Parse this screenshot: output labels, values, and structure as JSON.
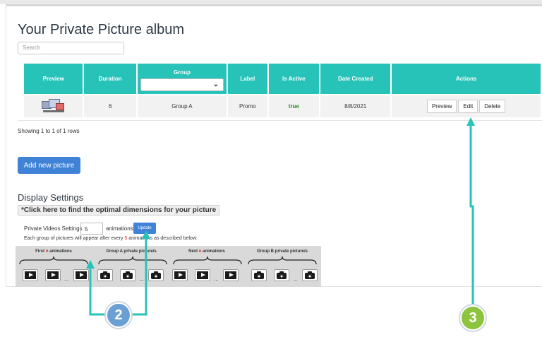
{
  "page": {
    "title": "Your Private Picture album",
    "search_placeholder": "Search"
  },
  "table": {
    "headers": {
      "preview": "Preview",
      "duration": "Duration",
      "group": "Group",
      "label": "Label",
      "is_active": "Is Active",
      "date_created": "Date Created",
      "actions": "Actions"
    },
    "group_filter_value": "",
    "rows": [
      {
        "duration": "6",
        "group": "Group A",
        "label": "Promo",
        "is_active": "true",
        "date_created": "8/8/2021",
        "actions": {
          "preview": "Preview",
          "edit": "Edit",
          "delete": "Delete"
        }
      }
    ],
    "showing_text": "Showing 1 to 1 of 1 rows"
  },
  "add_button_label": "Add new picture",
  "display_settings": {
    "title": "Display Settings",
    "link_text": "*Click here to find the optimal dimensions for your picture",
    "private_videos_label": "Private Videos Settings",
    "animations_value": "5",
    "animations_label": "animations",
    "update_label": "Update",
    "description_before": "Each group of pictures will appear after every",
    "description_value": "5",
    "description_after": "animations as described below:"
  },
  "diagram": {
    "segments": [
      {
        "label_before": "First",
        "label_n": "n",
        "label_after": "animations",
        "icon": "play-icon"
      },
      {
        "label_before": "Group A private picture/s",
        "label_n": "",
        "label_after": "",
        "icon": "camera-icon"
      },
      {
        "label_before": "Next",
        "label_n": "n",
        "label_after": "animations",
        "icon": "play-icon"
      },
      {
        "label_before": "Group B private picture/s",
        "label_n": "",
        "label_after": "",
        "icon": "camera-icon"
      }
    ],
    "ellipsis": "..."
  },
  "callouts": {
    "badge_2": "2",
    "badge_3": "3",
    "color_teal": "#27c2b8",
    "color_blue": "#6c9fd3",
    "color_green": "#8dc43d"
  }
}
